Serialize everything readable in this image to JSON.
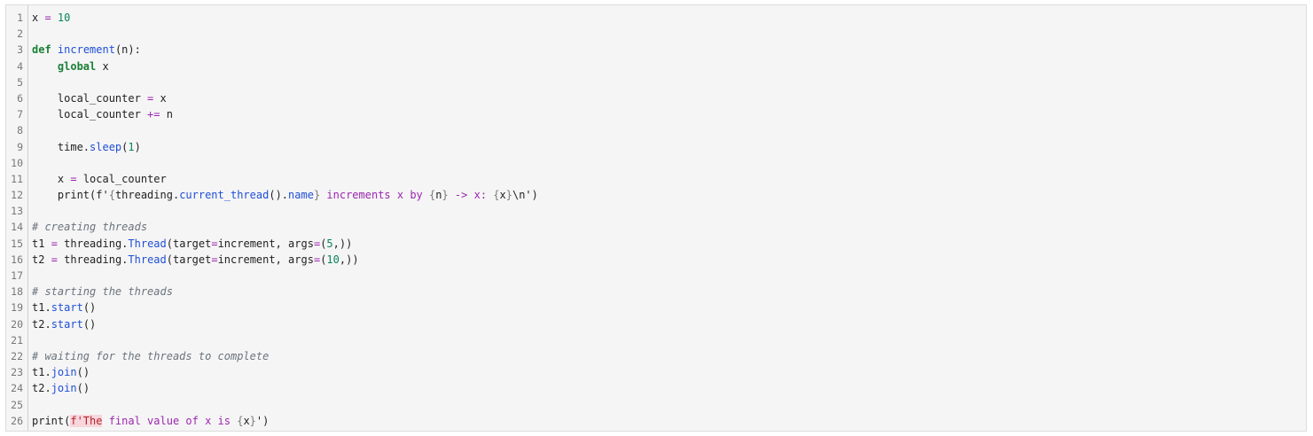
{
  "editor": {
    "lines": [
      {
        "n": "1",
        "tokens": [
          {
            "t": "x ",
            "c": "plain"
          },
          {
            "t": "=",
            "c": "op"
          },
          {
            "t": " ",
            "c": "plain"
          },
          {
            "t": "10",
            "c": "num"
          }
        ]
      },
      {
        "n": "2",
        "tokens": []
      },
      {
        "n": "3",
        "tokens": [
          {
            "t": "def",
            "c": "kw"
          },
          {
            "t": " ",
            "c": "plain"
          },
          {
            "t": "increment",
            "c": "fn"
          },
          {
            "t": "(n):",
            "c": "plain"
          }
        ]
      },
      {
        "n": "4",
        "tokens": [
          {
            "t": "    ",
            "c": "plain"
          },
          {
            "t": "global",
            "c": "kw"
          },
          {
            "t": " x",
            "c": "plain"
          }
        ]
      },
      {
        "n": "5",
        "tokens": []
      },
      {
        "n": "6",
        "tokens": [
          {
            "t": "    local_counter ",
            "c": "plain"
          },
          {
            "t": "=",
            "c": "op"
          },
          {
            "t": " x",
            "c": "plain"
          }
        ]
      },
      {
        "n": "7",
        "tokens": [
          {
            "t": "    local_counter ",
            "c": "plain"
          },
          {
            "t": "+=",
            "c": "op"
          },
          {
            "t": " n",
            "c": "plain"
          }
        ]
      },
      {
        "n": "8",
        "tokens": []
      },
      {
        "n": "9",
        "tokens": [
          {
            "t": "    time.",
            "c": "plain"
          },
          {
            "t": "sleep",
            "c": "attr"
          },
          {
            "t": "(",
            "c": "plain"
          },
          {
            "t": "1",
            "c": "num"
          },
          {
            "t": ")",
            "c": "plain"
          }
        ]
      },
      {
        "n": "10",
        "tokens": []
      },
      {
        "n": "11",
        "tokens": [
          {
            "t": "    x ",
            "c": "plain"
          },
          {
            "t": "=",
            "c": "op"
          },
          {
            "t": " local_counter",
            "c": "plain"
          }
        ]
      },
      {
        "n": "12",
        "tokens": [
          {
            "t": "    print(f'",
            "c": "plain"
          },
          {
            "t": "{",
            "c": "brace"
          },
          {
            "t": "threading.",
            "c": "plain"
          },
          {
            "t": "current_thread",
            "c": "attr"
          },
          {
            "t": "().",
            "c": "plain"
          },
          {
            "t": "name",
            "c": "attr"
          },
          {
            "t": "}",
            "c": "brace"
          },
          {
            "t": " increments x by ",
            "c": "op"
          },
          {
            "t": "{",
            "c": "brace"
          },
          {
            "t": "n",
            "c": "plain"
          },
          {
            "t": "}",
            "c": "brace"
          },
          {
            "t": " -> x: ",
            "c": "op"
          },
          {
            "t": "{",
            "c": "brace"
          },
          {
            "t": "x",
            "c": "plain"
          },
          {
            "t": "}",
            "c": "brace"
          },
          {
            "t": "\\n')",
            "c": "plain"
          }
        ]
      },
      {
        "n": "13",
        "tokens": []
      },
      {
        "n": "14",
        "tokens": [
          {
            "t": "# creating threads",
            "c": "cmt"
          }
        ]
      },
      {
        "n": "15",
        "tokens": [
          {
            "t": "t1 ",
            "c": "plain"
          },
          {
            "t": "=",
            "c": "op"
          },
          {
            "t": " threading.",
            "c": "plain"
          },
          {
            "t": "Thread",
            "c": "attr"
          },
          {
            "t": "(target",
            "c": "plain"
          },
          {
            "t": "=",
            "c": "op"
          },
          {
            "t": "increment, args",
            "c": "plain"
          },
          {
            "t": "=",
            "c": "op"
          },
          {
            "t": "(",
            "c": "plain"
          },
          {
            "t": "5",
            "c": "num"
          },
          {
            "t": ",))",
            "c": "plain"
          }
        ]
      },
      {
        "n": "16",
        "tokens": [
          {
            "t": "t2 ",
            "c": "plain"
          },
          {
            "t": "=",
            "c": "op"
          },
          {
            "t": " threading.",
            "c": "plain"
          },
          {
            "t": "Thread",
            "c": "attr"
          },
          {
            "t": "(target",
            "c": "plain"
          },
          {
            "t": "=",
            "c": "op"
          },
          {
            "t": "increment, args",
            "c": "plain"
          },
          {
            "t": "=",
            "c": "op"
          },
          {
            "t": "(",
            "c": "plain"
          },
          {
            "t": "10",
            "c": "num"
          },
          {
            "t": ",))",
            "c": "plain"
          }
        ]
      },
      {
        "n": "17",
        "tokens": []
      },
      {
        "n": "18",
        "tokens": [
          {
            "t": "# starting the threads",
            "c": "cmt"
          }
        ]
      },
      {
        "n": "19",
        "tokens": [
          {
            "t": "t1.",
            "c": "plain"
          },
          {
            "t": "start",
            "c": "attr"
          },
          {
            "t": "()",
            "c": "plain"
          }
        ]
      },
      {
        "n": "20",
        "tokens": [
          {
            "t": "t2.",
            "c": "plain"
          },
          {
            "t": "start",
            "c": "attr"
          },
          {
            "t": "()",
            "c": "plain"
          }
        ]
      },
      {
        "n": "21",
        "tokens": []
      },
      {
        "n": "22",
        "tokens": [
          {
            "t": "# waiting for the threads to complete",
            "c": "cmt"
          }
        ]
      },
      {
        "n": "23",
        "tokens": [
          {
            "t": "t1.",
            "c": "plain"
          },
          {
            "t": "join",
            "c": "attr"
          },
          {
            "t": "()",
            "c": "plain"
          }
        ]
      },
      {
        "n": "24",
        "tokens": [
          {
            "t": "t2.",
            "c": "plain"
          },
          {
            "t": "join",
            "c": "attr"
          },
          {
            "t": "()",
            "c": "plain"
          }
        ]
      },
      {
        "n": "25",
        "tokens": []
      },
      {
        "n": "26",
        "tokens": [
          {
            "t": "print(",
            "c": "plain"
          },
          {
            "t": "f'The",
            "c": "err"
          },
          {
            "t": " final value of x is ",
            "c": "op"
          },
          {
            "t": "{",
            "c": "brace"
          },
          {
            "t": "x",
            "c": "plain"
          },
          {
            "t": "}",
            "c": "brace"
          },
          {
            "t": "')",
            "c": "plain"
          }
        ]
      }
    ]
  }
}
